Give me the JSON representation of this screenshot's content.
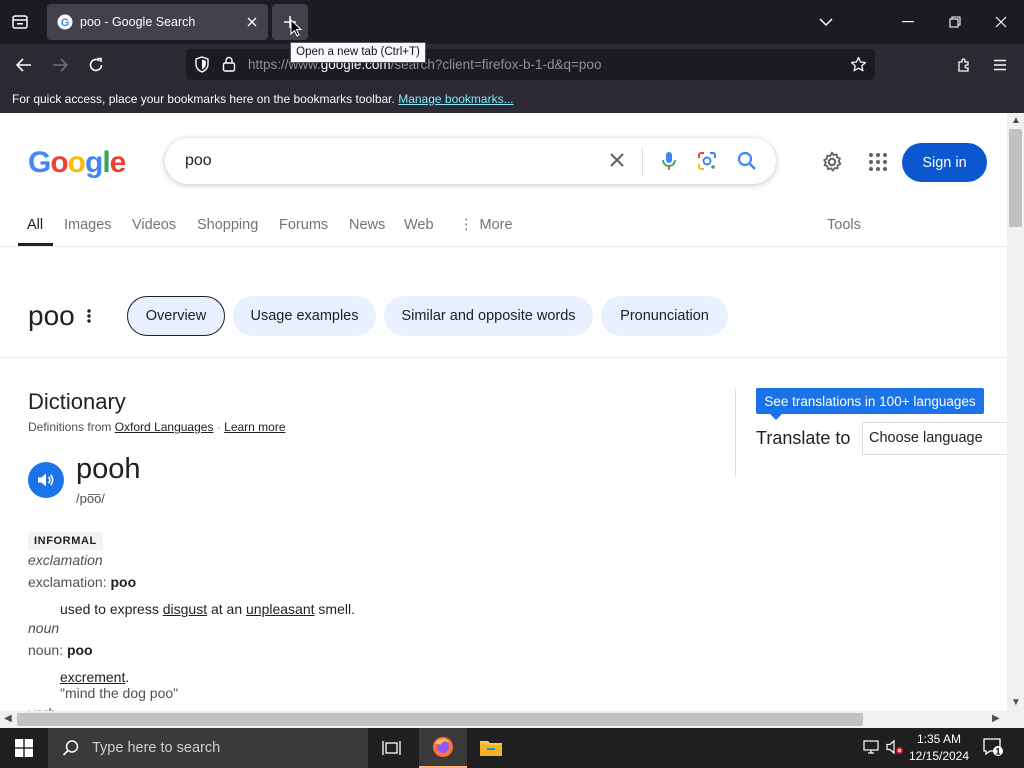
{
  "browser": {
    "tab": {
      "title": "poo - Google Search"
    },
    "tooltip": "Open a new tab (Ctrl+T)",
    "url": {
      "prefix": "https://www.",
      "host": "google.com",
      "rest": "/search?client=firefox-b-1-d&q=poo"
    },
    "bookmarks": {
      "message": "For quick access, place your bookmarks here on the bookmarks toolbar.",
      "link": "Manage bookmarks..."
    }
  },
  "google": {
    "logo": "Google",
    "query": "poo",
    "signin": "Sign in",
    "tabs": [
      "All",
      "Images",
      "Videos",
      "Shopping",
      "Forums",
      "News",
      "Web",
      "More",
      "Tools"
    ]
  },
  "word_panel": {
    "word": "poo",
    "chips": [
      "Overview",
      "Usage examples",
      "Similar and opposite words",
      "Pronunciation"
    ]
  },
  "dictionary": {
    "heading": "Dictionary",
    "source_prefix": "Definitions from",
    "source": "Oxford Languages",
    "separator": "·",
    "learn_more": "Learn more",
    "headword": "pooh",
    "pronunciation": "/po͞o/",
    "register": "INFORMAL",
    "entries": [
      {
        "pos": "exclamation",
        "posline_label": "exclamation:",
        "posline_word": "poo",
        "def_parts": [
          "used to express ",
          "disgust",
          " at an ",
          "unpleasant",
          " smell."
        ]
      },
      {
        "pos": "noun",
        "posline_label": "noun:",
        "posline_word": "poo",
        "def_parts": [
          "excrement",
          "."
        ],
        "example": "\"mind the dog poo\""
      }
    ],
    "next_pos_partial": "verb"
  },
  "translate": {
    "badge": "See translations in 100+ languages",
    "label": "Translate to",
    "select_value": "Choose language"
  },
  "taskbar": {
    "search_placeholder": "Type here to search",
    "time": "1:35 AM",
    "date": "12/15/2024",
    "notification_count": "1"
  },
  "colors": {
    "google_blue": "#0b57d0",
    "chip_bg": "#e8f0fe",
    "firefox_dark": "#1c1b22"
  }
}
